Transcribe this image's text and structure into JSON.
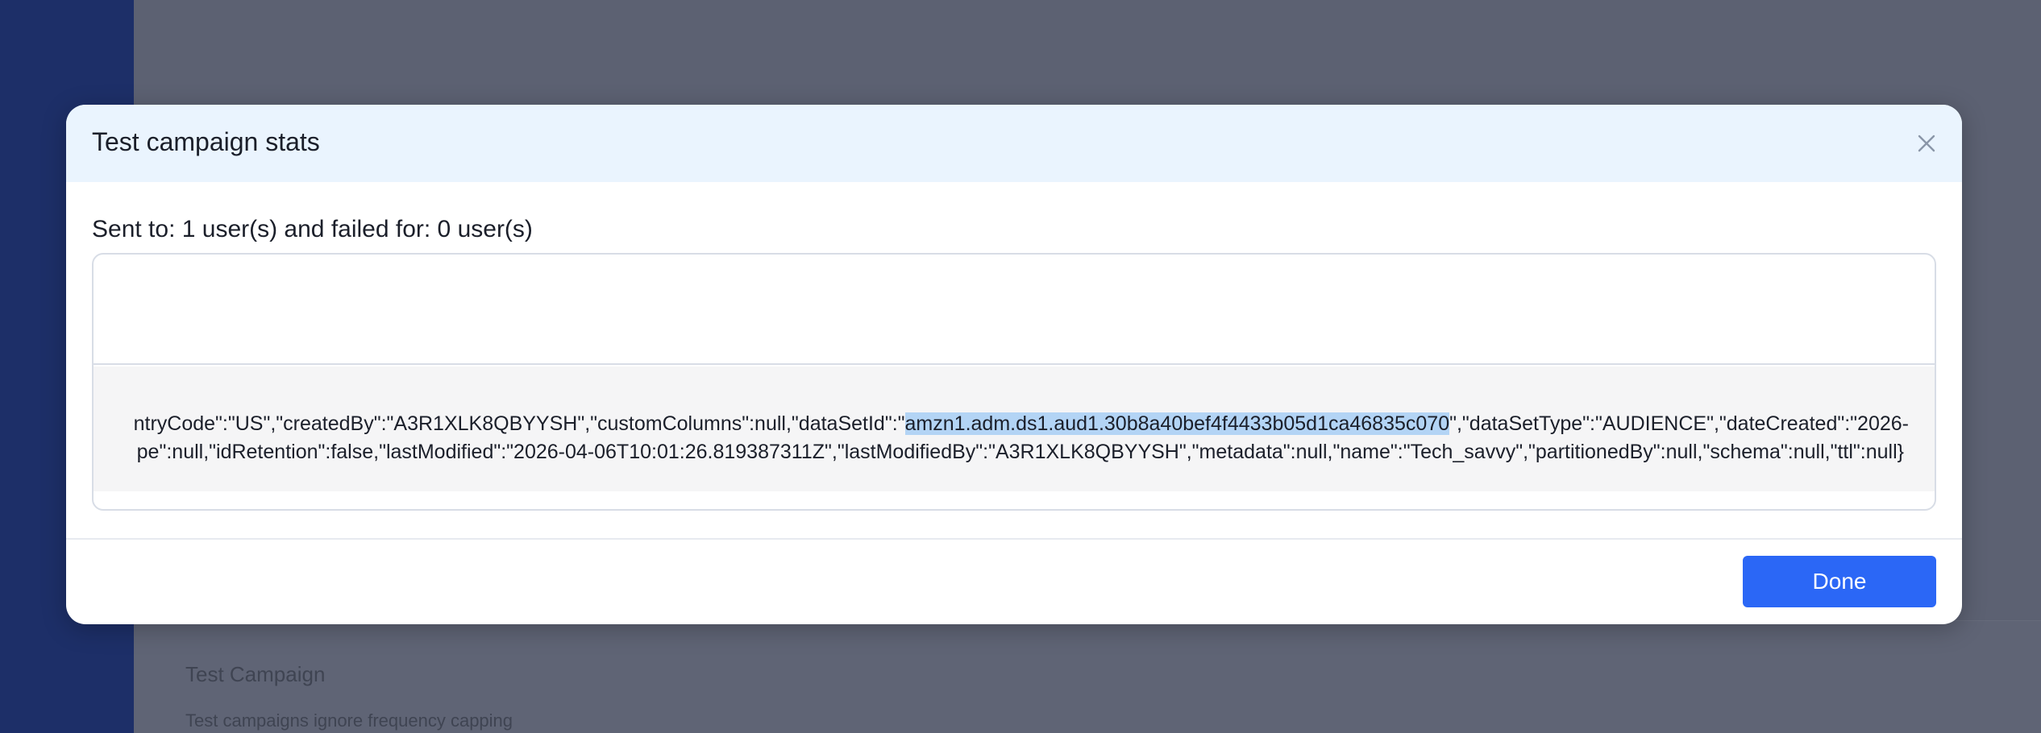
{
  "background": {
    "card_title": "Test Campaign",
    "card_subtitle": "Test campaigns ignore frequency capping"
  },
  "modal": {
    "title": "Test campaign stats",
    "close_icon": "close-icon",
    "sent_summary": "Sent to: 1 user(s) and failed for: 0 user(s)",
    "response": {
      "line1_prefix": "ntryCode\":\"US\",\"createdBy\":\"A3R1XLK8QBYYSH\",\"customColumns\":null,\"dataSetId\":\"",
      "line1_selected": "amzn1.adm.ds1.aud1.30b8a40bef4f4433b05d1ca46835c070",
      "line1_suffix": "\",\"dataSetType\":\"AUDIENCE\",\"dateCreated\":\"2026-",
      "line2": "pe\":null,\"idRetention\":false,\"lastModified\":\"2026-04-06T10:01:26.819387311Z\",\"lastModifiedBy\":\"A3R1XLK8QBYYSH\",\"metadata\":null,\"name\":\"Tech_savvy\",\"partitionedBy\":null,\"schema\":null,\"ttl\":null}"
    },
    "done_label": "Done"
  },
  "colors": {
    "overlay": "#5c6172",
    "sidebar": "#1d2f68",
    "header_bg": "#eaf4fe",
    "primary": "#2b67f6",
    "selection": "#b3d4f5",
    "code_bg": "#f5f5f6"
  }
}
